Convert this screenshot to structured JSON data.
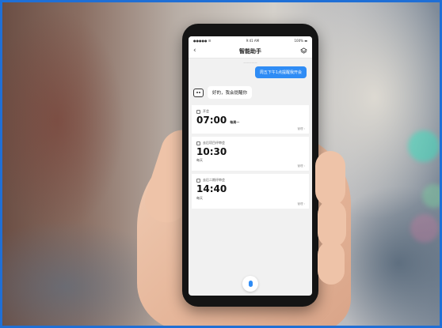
{
  "status_bar": {
    "carrier": "●●●●● ☰",
    "time": "9:41 AM",
    "battery": "100% ▬"
  },
  "nav": {
    "back_label": "‹",
    "title": "智能助手"
  },
  "chat": {
    "timestamp": "—————",
    "user_message": "周五下午1点提醒我开会",
    "bot_message": "好的，我会提醒你"
  },
  "reminders": [
    {
      "title": "开会",
      "time": "07:00",
      "repeat": "每周一",
      "manage": "管理 ›"
    },
    {
      "title": "去后项目评审会",
      "time": "10:30",
      "repeat": "每天",
      "manage": "管理 ›"
    },
    {
      "title": "去后二期评审会",
      "time": "14:40",
      "repeat": "每天",
      "manage": "管理 ›"
    }
  ],
  "icons": {
    "back": "chevron-left-icon",
    "menu": "layers-icon",
    "bot": "robot-icon",
    "calendar": "calendar-icon",
    "mic": "microphone-icon"
  },
  "colors": {
    "accent": "#2f8cf5",
    "frame_border": "#1f6fd6"
  }
}
